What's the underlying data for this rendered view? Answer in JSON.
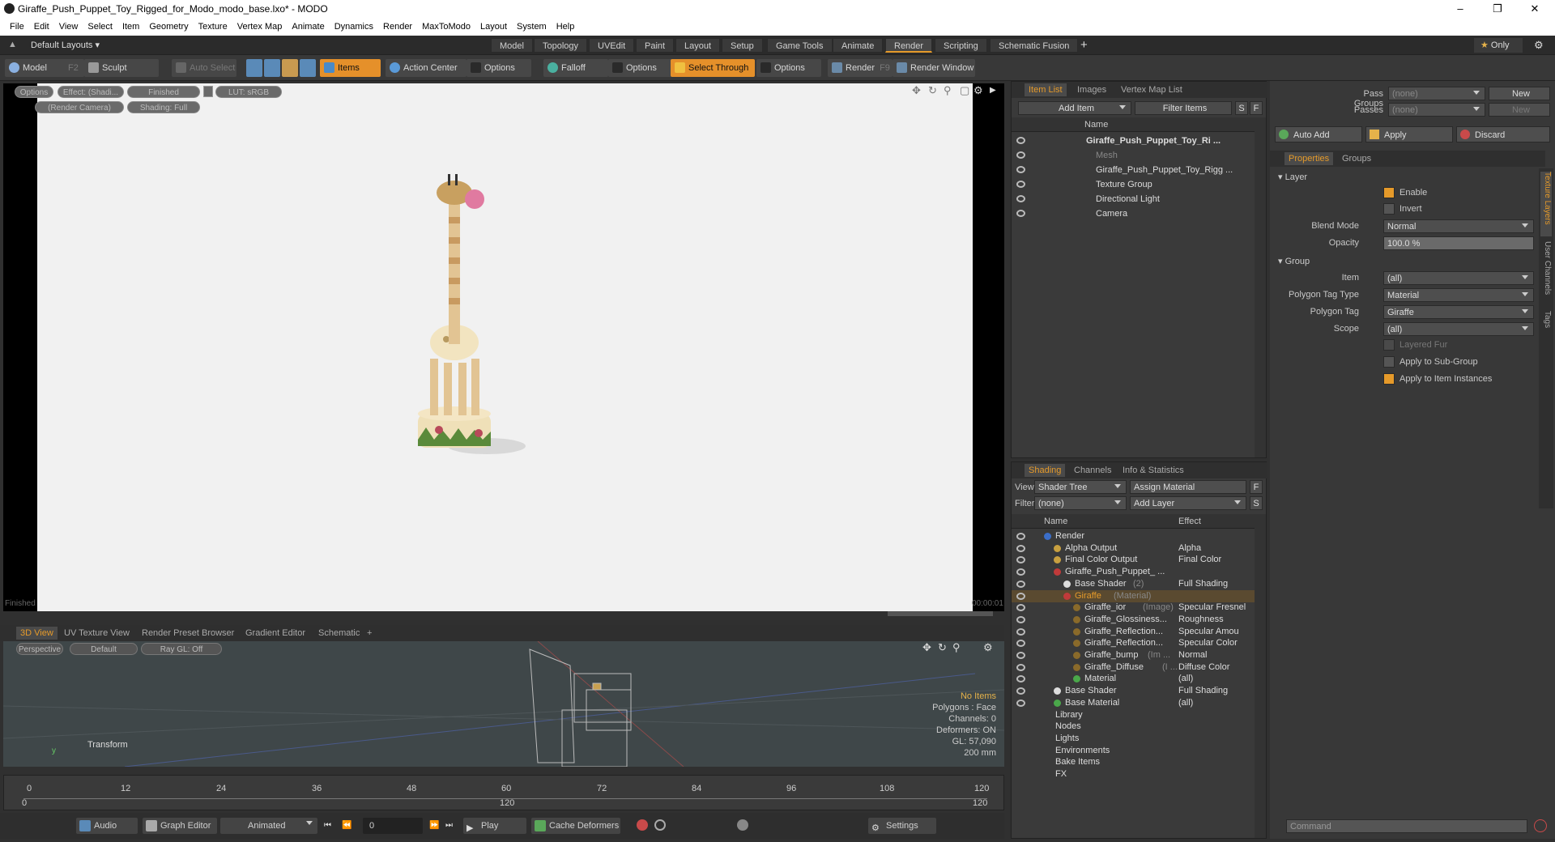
{
  "window": {
    "title": "Giraffe_Push_Puppet_Toy_Rigged_for_Modo_modo_base.lxo* - MODO",
    "minimize": "–",
    "maximize": "❐",
    "close": "✕"
  },
  "menu": [
    "File",
    "Edit",
    "View",
    "Select",
    "Item",
    "Geometry",
    "Texture",
    "Vertex Map",
    "Animate",
    "Dynamics",
    "Render",
    "MaxToModo",
    "Layout",
    "System",
    "Help"
  ],
  "layouts": {
    "current": "Default Layouts",
    "tabs": [
      "Model",
      "Topology",
      "UVEdit",
      "Paint",
      "Layout",
      "Setup",
      "Game Tools",
      "Animate",
      "Render",
      "Scripting",
      "Schematic Fusion"
    ],
    "active": "Render",
    "plus": "+",
    "only": "Only"
  },
  "toolbar": {
    "model": "Model",
    "model_key": "F2",
    "sculpt": "Sculpt",
    "auto_select": "Auto Select",
    "items": "Items",
    "action_center": "Action Center",
    "options1": "Options",
    "falloff": "Falloff",
    "options2": "Options",
    "select_through": "Select Through",
    "options3": "Options",
    "render": "Render",
    "render_key": "F9",
    "render_window": "Render Window"
  },
  "render_view": {
    "options": "Options",
    "effect": "Effect: (Shadi...",
    "finished": "Finished",
    "lut": "LUT: sRGB",
    "camera": "(Render Camera)",
    "shading": "Shading: Full",
    "status": "Finished",
    "time": "00:00:01"
  },
  "bottom_tabs": {
    "tabs": [
      "3D View",
      "UV Texture View",
      "Render Preset Browser",
      "Gradient Editor",
      "Schematic"
    ],
    "active": "3D View",
    "plus": "+"
  },
  "view3d": {
    "perspective": "Perspective",
    "default": "Default",
    "raygl": "Ray GL: Off",
    "transform": "Transform",
    "stats": {
      "no_items": "No Items",
      "polygons": "Polygons : Face",
      "channels": "Channels: 0",
      "deformers": "Deformers: ON",
      "gl": "GL: 57,090",
      "size": "200 mm"
    }
  },
  "timeline": {
    "top": [
      "0",
      "12",
      "24",
      "36",
      "48",
      "60",
      "72",
      "84",
      "96",
      "108",
      "120"
    ],
    "bottom": [
      "0",
      "120",
      "120"
    ]
  },
  "transport": {
    "audio": "Audio",
    "graph_editor": "Graph Editor",
    "animated": "Animated",
    "frame": "0",
    "play": "Play",
    "cache": "Cache Deformers",
    "settings": "Settings"
  },
  "itemlist": {
    "tabs": [
      "Item List",
      "Images",
      "Vertex Map List"
    ],
    "active": "Item List",
    "add_item": "Add Item",
    "filter_items": "Filter Items",
    "s": "S",
    "f": "F",
    "col_name": "Name",
    "rows": [
      {
        "label": "Giraffe_Push_Puppet_Toy_Ri ...",
        "indent": 0
      },
      {
        "label": "Mesh",
        "indent": 1
      },
      {
        "label": "Giraffe_Push_Puppet_Toy_Rigg ...",
        "indent": 1
      },
      {
        "label": "Texture Group",
        "indent": 1
      },
      {
        "label": "Directional Light",
        "indent": 1
      },
      {
        "label": "Camera",
        "indent": 1
      }
    ]
  },
  "shading": {
    "tabs": [
      "Shading",
      "Channels",
      "Info & Statistics"
    ],
    "active": "Shading",
    "view_label": "View",
    "view": "Shader Tree",
    "assign": "Assign Material",
    "filter_label": "Filter",
    "filter": "(none)",
    "add_layer": "Add Layer",
    "f": "F",
    "s": "S",
    "col_name": "Name",
    "col_effect": "Effect",
    "rows": [
      {
        "name": "Render",
        "effect": "",
        "indent": 0,
        "color": "#3b6ec9"
      },
      {
        "name": "Alpha Output",
        "effect": "Alpha",
        "indent": 1,
        "color": "#c8a040"
      },
      {
        "name": "Final Color Output",
        "effect": "Final Color",
        "indent": 1,
        "color": "#c8a040"
      },
      {
        "name": "Giraffe_Push_Puppet_ ...",
        "effect": "",
        "indent": 1,
        "color": "#c03a3a"
      },
      {
        "name": "Base Shader",
        "sub": "(2)",
        "effect": "Full Shading",
        "indent": 2,
        "color": "#dddddd"
      },
      {
        "name": "Giraffe",
        "sub": "(Material)",
        "effect": "",
        "indent": 2,
        "color": "#c03a3a",
        "selected": true
      },
      {
        "name": "Giraffe_ior",
        "sub": "(Image)",
        "effect": "Specular Fresnel",
        "indent": 3,
        "color": "#8a6a2a"
      },
      {
        "name": "Giraffe_Glossiness...",
        "effect": "Roughness",
        "indent": 3,
        "color": "#8a6a2a"
      },
      {
        "name": "Giraffe_Reflection...",
        "effect": "Specular Amou",
        "indent": 3,
        "color": "#8a6a2a"
      },
      {
        "name": "Giraffe_Reflection...",
        "effect": "Specular Color",
        "indent": 3,
        "color": "#8a6a2a"
      },
      {
        "name": "Giraffe_bump",
        "sub": "(Im ...",
        "effect": "Normal",
        "indent": 3,
        "color": "#8a6a2a"
      },
      {
        "name": "Giraffe_Diffuse",
        "sub": "(I ...",
        "effect": "Diffuse Color",
        "indent": 3,
        "color": "#8a6a2a"
      },
      {
        "name": "Material",
        "effect": "(all)",
        "indent": 3,
        "color": "#4aa84a"
      },
      {
        "name": "Base Shader",
        "effect": "Full Shading",
        "indent": 1,
        "color": "#dddddd"
      },
      {
        "name": "Base Material",
        "effect": "(all)",
        "indent": 1,
        "color": "#4aa84a"
      },
      {
        "name": "Library",
        "effect": "",
        "indent": 0,
        "color": ""
      },
      {
        "name": "Nodes",
        "effect": "",
        "indent": 0,
        "color": ""
      },
      {
        "name": "Lights",
        "effect": "",
        "indent": 0,
        "color": ""
      },
      {
        "name": "Environments",
        "effect": "",
        "indent": 0,
        "color": ""
      },
      {
        "name": "Bake Items",
        "effect": "",
        "indent": 0,
        "color": ""
      },
      {
        "name": "FX",
        "effect": "",
        "indent": 0,
        "color": ""
      }
    ]
  },
  "props": {
    "pass_groups_label": "Pass Groups",
    "pass_groups": "(none)",
    "new1": "New",
    "passes_label": "Passes",
    "passes": "(none)",
    "new2": "New",
    "auto_add": "Auto Add",
    "apply": "Apply",
    "discard": "Discard",
    "tabs": [
      "Properties",
      "Groups"
    ],
    "active": "Properties",
    "layer_section": "Layer",
    "enable": "Enable",
    "invert": "Invert",
    "blend_mode_label": "Blend Mode",
    "blend_mode": "Normal",
    "opacity_label": "Opacity",
    "opacity": "100.0 %",
    "group_section": "Group",
    "item_label": "Item",
    "item": "(all)",
    "ptt_label": "Polygon Tag Type",
    "ptt": "Material",
    "pt_label": "Polygon Tag",
    "pt": "Giraffe",
    "scope_label": "Scope",
    "scope": "(all)",
    "layered_fur": "Layered Fur",
    "apply_sub": "Apply to Sub-Group",
    "apply_inst": "Apply to Item Instances",
    "side_tabs": [
      "Texture Layers",
      "User Channels",
      "Tags"
    ],
    "command": "Command"
  },
  "colors": {
    "accent": "#e59a2a"
  }
}
